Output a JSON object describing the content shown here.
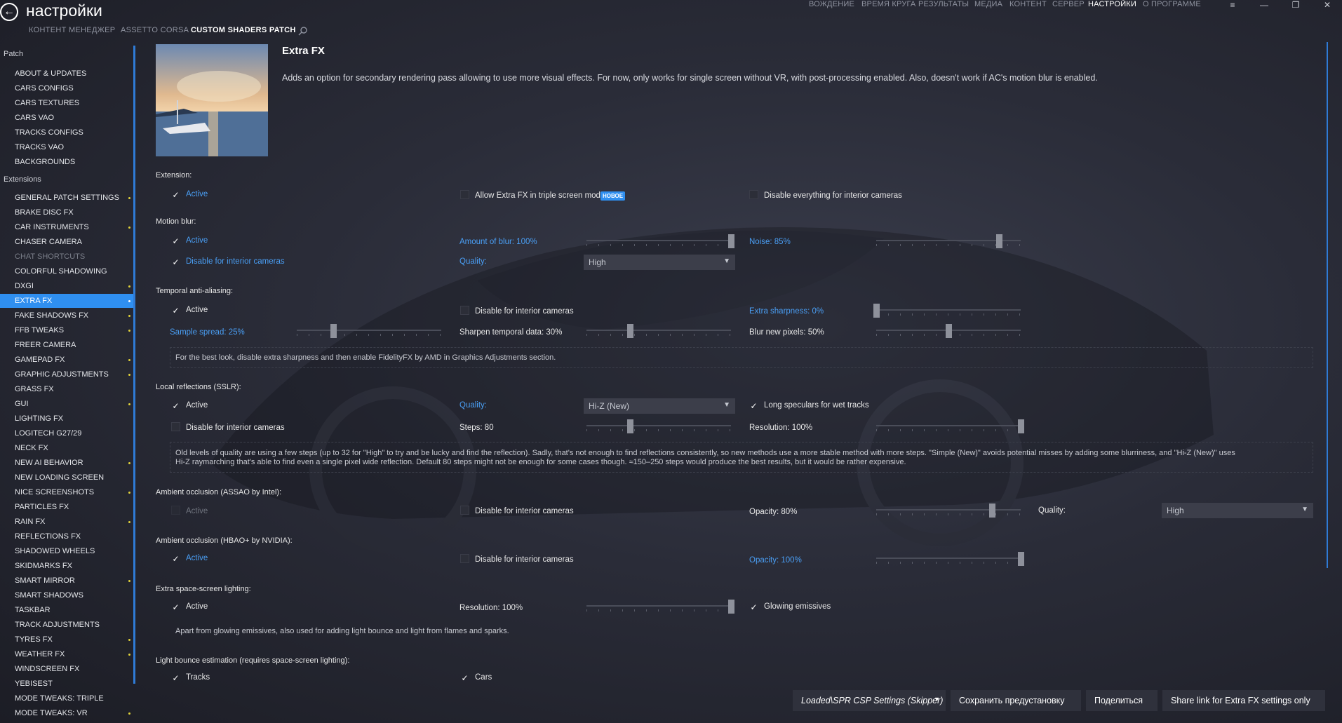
{
  "header": {
    "title": "настройки",
    "subtabs": [
      "КОНТЕНТ МЕНЕДЖЕР",
      "ASSETTO CORSA",
      "CUSTOM SHADERS PATCH"
    ],
    "topnav": [
      "ВОЖДЕНИЕ",
      "ВРЕМЯ КРУГА",
      "РЕЗУЛЬТАТЫ",
      "МЕДИА",
      "КОНТЕНТ",
      "СЕРВЕР",
      "НАСТРОЙКИ",
      "О ПРОГРАММЕ"
    ]
  },
  "sidebar": {
    "patch_header": "Patch",
    "patch_items": [
      "ABOUT & UPDATES",
      "CARS CONFIGS",
      "CARS TEXTURES",
      "CARS VAO",
      "TRACKS CONFIGS",
      "TRACKS VAO",
      "BACKGROUNDS"
    ],
    "extensions_header": "Extensions",
    "ext_items": [
      "GENERAL PATCH SETTINGS",
      "BRAKE DISC FX",
      "CAR INSTRUMENTS",
      "CHASER CAMERA",
      "CHAT SHORTCUTS",
      "COLORFUL SHADOWING",
      "DXGI",
      "EXTRA FX",
      "FAKE SHADOWS FX",
      "FFB TWEAKS",
      "FREER CAMERA",
      "GAMEPAD FX",
      "GRAPHIC ADJUSTMENTS",
      "GRASS FX",
      "GUI",
      "LIGHTING FX",
      "LOGITECH G27/29",
      "NECK FX",
      "NEW AI BEHAVIOR",
      "NEW LOADING SCREEN",
      "NICE SCREENSHOTS",
      "PARTICLES FX",
      "RAIN FX",
      "REFLECTIONS FX",
      "SHADOWED WHEELS",
      "SKIDMARKS FX",
      "SMART MIRROR",
      "SMART SHADOWS",
      "TASKBAR",
      "TRACK ADJUSTMENTS",
      "TYRES FX",
      "WEATHER FX",
      "WINDSCREEN FX",
      "YEBISEST",
      "MODE TWEAKS: TRIPLE",
      "MODE TWEAKS: VR"
    ],
    "selected": "EXTRA FX",
    "dimmed": "CHAT SHORTCUTS"
  },
  "content": {
    "title": "Extra FX",
    "description": "Adds an option for secondary rendering pass allowing to use more visual effects. For now, only works for single screen without VR, with post-processing enabled. Also, doesn't work if AC's motion blur is enabled.",
    "extension": {
      "label": "Extension:",
      "active": "Active",
      "allow_triple": "Allow Extra FX in triple screen mod",
      "new_badge": "НОВОЕ",
      "disable_interior": "Disable everything for interior cameras"
    },
    "motion_blur": {
      "label": "Motion blur:",
      "active": "Active",
      "disable_interior": "Disable for interior cameras",
      "amount": "Amount of blur: 100%",
      "amount_value": 1.0,
      "noise": "Noise: 85%",
      "noise_value": 0.85,
      "quality_label": "Quality:",
      "quality_value": "High"
    },
    "taa": {
      "label": "Temporal anti-aliasing:",
      "active": "Active",
      "disable_interior": "Disable for interior cameras",
      "extra_sharpness": "Extra sharpness: 0%",
      "extra_sharpness_value": 0.0,
      "sample_spread": "Sample spread: 25%",
      "sample_spread_value": 0.25,
      "sharpen": "Sharpen temporal data: 30%",
      "sharpen_value": 0.3,
      "blur_new": "Blur new pixels: 50%",
      "blur_new_value": 0.5,
      "note": "For the best look, disable extra sharpness and then enable FidelityFX by AMD in Graphics Adjustments section."
    },
    "sslr": {
      "label": "Local reflections (SSLR):",
      "active": "Active",
      "disable_interior": "Disable for interior cameras",
      "quality_label": "Quality:",
      "quality_value": "Hi-Z (New)",
      "long_speculars": "Long speculars for wet tracks",
      "steps": "Steps: 80",
      "steps_value": 0.3,
      "resolution": "Resolution: 100%",
      "resolution_value": 1.0,
      "note_line1": "Old levels of quality are using a few steps (up to 32 for \"High\" to try and be lucky and find the reflection). Sadly, that's not enough to find reflections consistently, so new methods use a more stable method with more steps. \"Simple (New)\" avoids potential misses by adding some blurriness, and \"Hi-Z (New)\" uses",
      "note_line2": "Hi-Z raymarching that's able to find even a single pixel wide reflection. Default 80 steps might not be enough for some cases though. ≈150–250 steps would produce the best results, but it would be rather expensive."
    },
    "assao": {
      "label": "Ambient occlusion (ASSAO by Intel):",
      "active": "Active",
      "disable_interior": "Disable for interior cameras",
      "opacity": "Opacity: 80%",
      "opacity_value": 0.8,
      "quality_label": "Quality:",
      "quality_value": "High"
    },
    "hbao": {
      "label": "Ambient occlusion (HBAO+ by NVIDIA):",
      "active": "Active",
      "disable_interior": "Disable for interior cameras",
      "opacity": "Opacity: 100%",
      "opacity_value": 1.0
    },
    "ssl": {
      "label": "Extra space-screen lighting:",
      "active": "Active",
      "resolution": "Resolution: 100%",
      "resolution_value": 1.0,
      "glowing": "Glowing emissives",
      "note": "Apart from glowing emissives, also used for adding light bounce and light from flames and sparks."
    },
    "light_bounce": {
      "label": "Light bounce estimation (requires space-screen lighting):",
      "tracks": "Tracks",
      "cars": "Cars"
    }
  },
  "bottom": {
    "preset": "Loaded\\SPR CSP Settings (Skipper)",
    "save": "Сохранить предустановку",
    "share": "Поделиться",
    "share_link": "Share link for Extra FX settings only"
  },
  "colors": {
    "accent": "#2f8ff0",
    "link": "#4a9ff5",
    "dot": "#e0d23a"
  }
}
